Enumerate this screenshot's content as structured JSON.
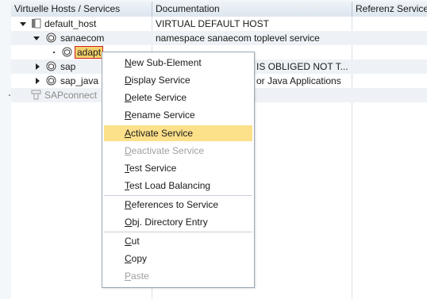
{
  "columns": {
    "col1": "Virtuelle Hosts / Services",
    "col2": "Documentation",
    "col3": "Referenz Service"
  },
  "tree": [
    {
      "label": "default_host",
      "doc": "VIRTUAL DEFAULT HOST",
      "icon": "host-icon"
    },
    {
      "label": "sanaecom",
      "doc": "namespace sanaecom toplevel service",
      "icon": "service-package-icon"
    },
    {
      "label": "adapt",
      "doc": "",
      "icon": "service-package-icon"
    },
    {
      "label": "sap",
      "doc": "IS OBLIGED NOT T...",
      "icon": "service-package-icon"
    },
    {
      "label": "sap_java",
      "doc": "or Java Applications",
      "icon": "service-package-icon"
    },
    {
      "label": "SAPconnect",
      "doc": "",
      "icon": "connect-icon"
    }
  ],
  "context_menu": {
    "items": [
      {
        "mnemonic": "N",
        "rest": "ew Sub-Element",
        "state": "enabled"
      },
      {
        "mnemonic": "D",
        "rest": "isplay Service",
        "state": "enabled"
      },
      {
        "mnemonic": "D",
        "rest": "elete Service",
        "state": "enabled"
      },
      {
        "mnemonic": "R",
        "rest": "ename Service",
        "state": "enabled"
      },
      {
        "mnemonic": "A",
        "rest": "ctivate Service",
        "state": "highlighted"
      },
      {
        "mnemonic": "D",
        "rest": "eactivate Service",
        "state": "disabled"
      },
      {
        "mnemonic": "T",
        "rest": "est Service",
        "state": "enabled"
      },
      {
        "mnemonic": "T",
        "rest": "est Load Balancing",
        "state": "enabled"
      },
      {
        "mnemonic": "R",
        "rest": "eferences to Service",
        "state": "enabled"
      },
      {
        "mnemonic": "O",
        "rest": "bj. Directory Entry",
        "state": "enabled"
      },
      {
        "mnemonic": "C",
        "rest": "ut",
        "state": "enabled"
      },
      {
        "mnemonic": "C",
        "rest": "opy",
        "state": "enabled"
      },
      {
        "mnemonic": "P",
        "rest": "aste",
        "state": "disabled"
      }
    ]
  },
  "colors": {
    "highlight": "#fce08a",
    "selection": "#f3d26b",
    "selection_border": "#d02020"
  }
}
